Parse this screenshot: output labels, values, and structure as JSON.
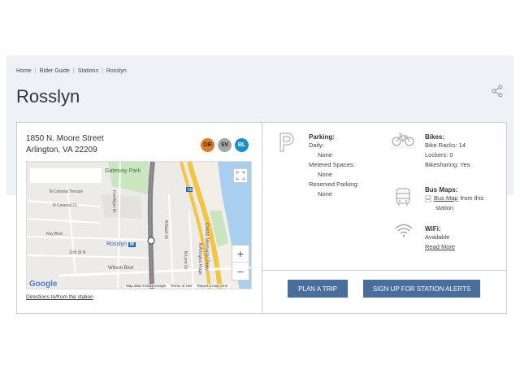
{
  "breadcrumb": [
    "Home",
    "Rider Guide",
    "Stations",
    "Rosslyn"
  ],
  "page_title": "Rosslyn",
  "address": {
    "line1": "1850 N. Moore Street",
    "line2": "Arlington, VA 22209"
  },
  "lines": [
    {
      "code": "OR",
      "color": "#e07b22"
    },
    {
      "code": "SV",
      "color": "#a5a7a8"
    },
    {
      "code": "BL",
      "color": "#1a8fd0"
    }
  ],
  "map": {
    "labels": {
      "gateway_park": "Gateway Park",
      "colonial_terrace": "N Colonial Terrace",
      "colonial_ct": "N Colonial Ct",
      "key_blvd": "Key Blvd",
      "11th": "11th St N",
      "wilson": "Wilson Blvd",
      "fort_myer": "Fort Myer Dr",
      "nash": "N Nash St",
      "lynn": "N Lynn St",
      "arlington_ridge": "N Arlington Ridge",
      "memorial": "Custis Memorial Pkwy",
      "station": "Rosslyn"
    },
    "google": "Google",
    "map_data": "Map data ©2021 Google",
    "terms": "Terms of Use",
    "report": "Report a map error",
    "zoom_in": "+",
    "zoom_out": "−"
  },
  "directions_link": "Directions to/from the station",
  "parking": {
    "title": "Parking:",
    "daily_label": "Daily:",
    "daily_value": "None",
    "metered_label": "Metered Spaces:",
    "metered_value": "None",
    "reserved_label": "Reserved Parking:",
    "reserved_value": "None"
  },
  "bikes": {
    "title": "Bikes:",
    "racks": "Bike Racks: 14",
    "lockers": "Lockers: 0",
    "sharing": "Bikesharing: Yes"
  },
  "bus_maps": {
    "title": "Bus Maps:",
    "link": "Bus Map",
    "suffix": " from this",
    "suffix2": "station"
  },
  "wifi": {
    "title": "WiFi:",
    "status": "Available",
    "read_more": "Read More"
  },
  "buttons": {
    "plan_trip": "PLAN A TRIP",
    "alerts": "SIGN UP FOR STATION ALERTS"
  }
}
